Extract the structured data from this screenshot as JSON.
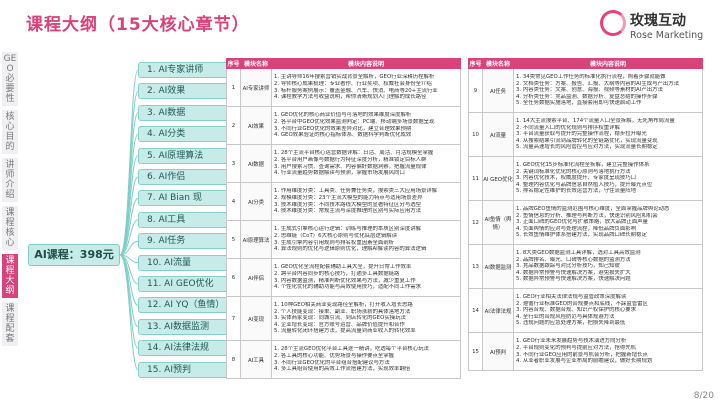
{
  "header": {
    "title": "课程大纲（15大核心章节）"
  },
  "logo": {
    "name": "玫瑰互动",
    "sub": "Rose Marketing"
  },
  "sidenav": [
    {
      "label": "GEO必要性",
      "active": false
    },
    {
      "label": "核心目的",
      "active": false
    },
    {
      "label": "讲师介绍",
      "active": false
    },
    {
      "label": "课程核心",
      "active": false
    },
    {
      "label": "课程大纲",
      "active": true
    },
    {
      "label": "课程配套",
      "active": false
    }
  ],
  "root": {
    "label": "AI课程：398元"
  },
  "topics": [
    "1. AI专家讲师",
    "2. AI效果",
    "3. AI数据",
    "4. AI分类",
    "5. AI原理算法",
    "6. AI作侣",
    "7. AI Bian 现",
    "8. AI工具",
    "9. AI任务",
    "10. AI流量",
    "11. AI GEO优化",
    "12. AI YQ（鱼情）",
    "13. AI数据监测",
    "14. AI法律法规",
    "15. AI预判"
  ],
  "table_headers": {
    "no": "序号",
    "name": "模块名称",
    "desc": "模块内容说明"
  },
  "left_table": [
    {
      "no": "1",
      "name": "AI专家讲师",
      "desc": [
        "1. 主讲导师16年搜索营销实战背景全解析，GEO行业深耕历程解析",
        "2. 导师核心成果梳理：专业著作、行业奖项、权威社会身份全介绍",
        "3. 标杆服务案例展示：覆盖金融、汽车、快消、电商等20+主流行业",
        "4. 课程教学方法与收益说明，帮你清晰规划入门理解的成长路径"
      ]
    },
    {
      "no": "2",
      "name": "AI效果",
      "desc": [
        "1. GEO优化的核心商业价值与可落地的效果维度深度解析",
        "2. 各平台中GEO优化效果监测判定：PC端、移动端多场景数据呈现",
        "3. 不同行业GEO优化的效果差异对比，建立合理效果预期",
        "4. GEO效果验证的核心指标体系、数据科学判断优化成效"
      ]
    },
    {
      "no": "3",
      "name": "AI数据",
      "desc": [
        "1. 28个主流平台核心运营数据详解：日活、周活、月活规模全掌握",
        "2. 各平台用户画像与数据行为特征深度分析，精准锁定目标人群",
        "3. 用户搜索习惯、查询需求、内容偏好数据洞察，把握流量规律",
        "4. 行业流量趋势数据解读与预测，掌握市场发展风向口"
      ]
    },
    {
      "no": "4",
      "name": "AI分类",
      "desc": [
        "1. 作用维度分类：工具类、任务兼任务类，搜索类三大应用场景详解",
        "2. 规模维度分类：23个主流大模型的能力特点与适用场景差异",
        "3. 技术维度分类：不同技术路线大模型的显著特征区分与选型",
        "4. 技术维度分类：常规主流与深度推理的区别与实际应用方法"
      ]
    },
    {
      "no": "5",
      "name": "AI原理算法",
      "desc": [
        "1. 生成式引擎核心运行逻辑：训练与推理的本质区别深度讲解",
        "2. 思维链（CoT）6大核心原则与优化底层逻辑解读",
        "3. 生成引擎内容引用规则与排名权重因素全面剖析",
        "4. 算法规则的优化与逻辑原则优化，理解AI解读内容的算法逻辑"
      ]
    },
    {
      "no": "6",
      "name": "AI伴侣",
      "desc": [
        "1. GEO优化全流程配套辅助工具大全，提升日常工作效率",
        "2. 跨平台内容同步的核心技巧，打通多工具数据链路",
        "3. 内容数据监测，精准判断优化效果与方法，减少重复工作",
        "4. 个性化优化的辅助功能与高效使用技巧，适配不同工作需求"
      ]
    },
    {
      "no": "7",
      "name": "AI变现",
      "desc": [
        "1. 10种GEO相关商业变现路径全解析，打开收入增长思路",
        "2. 个人技能变现：接单、副业、职场涨薪的具体落地方法",
        "3. 实体商家变现：同城引流、到店转化的GEO实操玩法",
        "4. 企业增长变现：官方账号运营、品牌价值提升和合作",
        "5. 流量转化闭环搭建方法，提高流量到商业收入的转化效率"
      ]
    },
    {
      "no": "8",
      "name": "AI工具",
      "desc": [
        "1. 28个主流GEO优化平台工具逐一精讲，吃透每个平台核心玩法",
        "2. 各工具的核心功能、优势场景与操作要点全掌握",
        "3. 不同行业GEO优化的平台组合搭配建议与方法",
        "4. 多工具组合使用的高效工作流搭建方法，实现效率翻倍"
      ]
    }
  ],
  "right_table": [
    {
      "no": "9",
      "name": "AI任务",
      "desc": [
        "1. 34类常见GEO工作任务的标准化执行流程，照着步骤就能做",
        "2. 文档类任务：方案、报告、汇报、大纲等内容的AI生成与产出方法",
        "3. 内容类任务：文案、创意、海报、视频等素材的AI产出方法",
        "4. 分析类任务：竞品监测、数据分析、复盘总结的操作步骤",
        "5. 全任务数据实施落地，直接套用即可快速启动工作"
      ]
    },
    {
      "no": "10",
      "name": "AI流量",
      "desc": [
        "1. 14大主流搜索平台、174个流量入口全景拆解，无死角布局流量",
        "2. 不同流量入口的优化规则与排序权重详解",
        "3. 平台流量获取与提升的完整操作流程，稳步拉升曝光",
        "4. 从搜索结果引流到品牌转化的全链路优化，实现流量变现",
        "5. 流量高速增长的风险管控与应对方法，实现流量长期稳定"
      ]
    },
    {
      "no": "11",
      "name": "AI GEO优化",
      "desc": [
        "1. GEO优化15步标准化流程全拆解，建立完整操作体系",
        "2. 关键词标准化优化的核心原则与落地执行方法",
        "3. 内容优化技术，权威度提升、专家度呈现技巧口",
        "4. 整理内容优化与品牌信息自然植入技巧，提升曝光点位",
        "5. 排名稳定性维护的长效运营方法，守住流量阵地"
      ]
    },
    {
      "no": "12",
      "name": "AI鱼情（舆情）",
      "desc": [
        "1. 品牌GEO鱼情的监测范围与核心维度，全面掌握品牌舆论动态",
        "2. 鱼情信息的分析、推理与判断方法，快速识别风险和机会",
        "3. 正面口碑的GEO优化与扩散策略，放大品牌正面声量",
        "4. 负面舆情的应对与处理流程，降低品牌负面影响",
        "5. 长效鱼情维护体系搭建方法，实现品牌口碑长期稳定"
      ]
    },
    {
      "no": "13",
      "name": "AI数据监测",
      "desc": [
        "1. 8大类GEO数据监测工具详解，选对工具高效监测",
        "2. 品牌排名、曝光、口碑等核心数据的监测方法",
        "3. 竞品数据跟踪与对比分析技巧，知己知彼",
        "4. 数据异常预警与快速解决方案，避免损失扩大",
        "5. 数据异常预警与快速解决方案，快速解决问题"
      ]
    },
    {
      "no": "14",
      "name": "AI法律法规",
      "desc": [
        "1. GEO行业相关法律法规与监管政策深度解读",
        "2. 遵循行业标准GEO的合规要点和底线，不踩监管雷区",
        "3. 内容合规、数据合规、知识产权保护的核心要求",
        "4. 全行业的合规风险防范与具体规避方法",
        "5. 违规问题的应急处理方案，把损失降到最低"
      ]
    },
    {
      "no": "15",
      "name": "AI预判",
      "desc": [
        "1. GEO行业未来发展趋势与技术演进方向分析",
        "2. 平台规则变化的预判与提前应对方法，抢得先机",
        "3. 不同行业GEO应用的前景与机会分析，把握新增长点",
        "4. 从业者职业发展与企业布局的前瞻建议，做好长期规划"
      ]
    }
  ],
  "footer": {
    "page": "8/20"
  },
  "colors": {
    "accent": "#d9427a",
    "mint": "#c6ebe8"
  }
}
